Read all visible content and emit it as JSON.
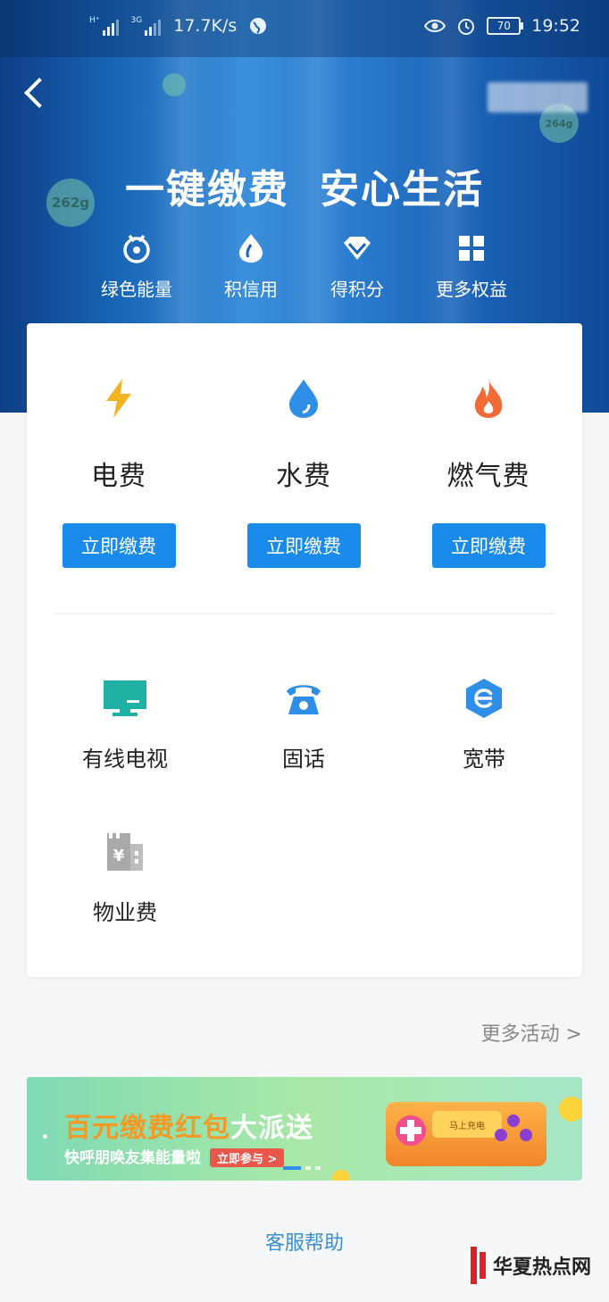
{
  "status_bar": {
    "network_type_1": "H⁺",
    "network_type_2": "3G",
    "speed": "17.7K/s",
    "battery": "70",
    "time": "19:52"
  },
  "hero": {
    "title_part1": "一键缴费",
    "title_part2": "安心生活",
    "bubble_left": "262g",
    "bubble_right": "264g",
    "quick_links": [
      {
        "label": "绿色能量",
        "icon": "green-energy-icon"
      },
      {
        "label": "积信用",
        "icon": "credit-icon"
      },
      {
        "label": "得积分",
        "icon": "diamond-icon"
      },
      {
        "label": "更多权益",
        "icon": "grid-icon"
      }
    ]
  },
  "utilities": [
    {
      "name": "电费",
      "button": "立即缴费",
      "icon": "lightning-icon",
      "color": "#f5b223"
    },
    {
      "name": "水费",
      "button": "立即缴费",
      "icon": "water-drop-icon",
      "color": "#2e8ee8"
    },
    {
      "name": "燃气费",
      "button": "立即缴费",
      "icon": "flame-icon",
      "color": "#f26a36"
    }
  ],
  "services": [
    {
      "name": "有线电视",
      "icon": "tv-icon",
      "color": "#1fb2a4"
    },
    {
      "name": "固话",
      "icon": "telephone-icon",
      "color": "#2e8ee8"
    },
    {
      "name": "宽带",
      "icon": "broadband-icon",
      "color": "#2e8ee8"
    },
    {
      "name": "物业费",
      "icon": "building-yen-icon",
      "color": "#a9a9a9"
    }
  ],
  "more_activities": "更多活动 >",
  "banner": {
    "title_orange": "百元缴费红包",
    "title_white": "大派送",
    "subtitle": "快呼朋唤友集能量啦",
    "join_button": "立即参与 >",
    "console_text": "马上充电"
  },
  "help_link": "客服帮助",
  "watermark": "华夏热点网"
}
